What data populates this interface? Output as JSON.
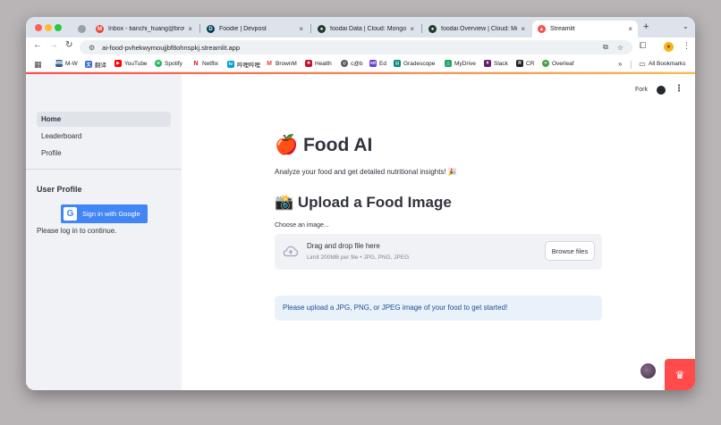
{
  "browser": {
    "tabs": [
      {
        "title": "",
        "favicon": "chrome-icon",
        "color": "#9aa0a6"
      },
      {
        "title": "Inbox - tianchi_huang@brown",
        "favicon": "gmail-icon",
        "color": "#ea4335"
      },
      {
        "title": "Foodie | Devpost",
        "favicon": "devpost-icon",
        "color": "#003e54"
      },
      {
        "title": "foodai Data | Cloud: MongoDB",
        "favicon": "mongodb-icon",
        "color": "#1e3a2b"
      },
      {
        "title": "foodai Overview | Cloud: Mon",
        "favicon": "mongodb-icon",
        "color": "#1e3a2b"
      },
      {
        "title": "Streamlit",
        "favicon": "streamlit-icon",
        "color": "#ff4b4b"
      }
    ],
    "new_tab_label": "+",
    "url": "ai-food-pvhekwymoujjbf8ohnspkj.streamlit.app",
    "profile_initial": "★",
    "bookmarks": [
      {
        "label": "M-W",
        "icon": "merriam-webster-icon",
        "color": "#2b5f8e"
      },
      {
        "label": "翻译",
        "icon": "translate-icon",
        "color": "#3b6bd6"
      },
      {
        "label": "YouTube",
        "icon": "youtube-icon",
        "color": "#ff0000"
      },
      {
        "label": "Spotify",
        "icon": "spotify-icon",
        "color": "#1db954"
      },
      {
        "label": "Netflix",
        "icon": "netflix-icon",
        "color": "#e50914"
      },
      {
        "label": "哔哩哔哩",
        "icon": "bilibili-icon",
        "color": "#00a1d6"
      },
      {
        "label": "BrownM",
        "icon": "gmail-icon",
        "color": "#ea4335"
      },
      {
        "label": "Health",
        "icon": "uk-flag-icon",
        "color": "#c8102e"
      },
      {
        "label": "c@b",
        "icon": "globe-icon",
        "color": "#555555"
      },
      {
        "label": "Ed",
        "icon": "ed-icon",
        "color": "#6b3fd4"
      },
      {
        "label": "Gradescope",
        "icon": "gradescope-icon",
        "color": "#00897b"
      },
      {
        "label": "MyDrive",
        "icon": "drive-icon",
        "color": "#1fa463"
      },
      {
        "label": "Slack",
        "icon": "slack-icon",
        "color": "#611f69"
      },
      {
        "label": "CR",
        "icon": "cr-icon",
        "color": "#222222"
      },
      {
        "label": "Overleaf",
        "icon": "overleaf-icon",
        "color": "#47a141"
      }
    ],
    "more_bookmarks": "»",
    "all_bookmarks": "All Bookmarks"
  },
  "sidebar": {
    "items": [
      {
        "label": "Home",
        "active": true
      },
      {
        "label": "Leaderboard",
        "active": false
      },
      {
        "label": "Profile",
        "active": false
      }
    ],
    "profile_heading": "User Profile",
    "google_button": "Sign in with Google",
    "login_message": "Please log in to continue."
  },
  "header": {
    "fork_label": "Fork"
  },
  "main": {
    "title": "🍎 Food AI",
    "subtitle": "Analyze your food and get detailed nutritional insights! 🎉",
    "upload_heading": "📸 Upload a Food Image",
    "choose_label": "Choose an image...",
    "dropzone_text": "Drag and drop file here",
    "dropzone_limit": "Limit 200MB per file • JPG, PNG, JPEG",
    "browse_button": "Browse files",
    "info_message": "Please upload a JPG, PNG, or JPEG image of your food to get started!"
  },
  "colors": {
    "accent": "#ff4b4b",
    "google_blue": "#4285f4",
    "info_text": "#1d4f91",
    "info_bg": "#e9f1fb"
  }
}
